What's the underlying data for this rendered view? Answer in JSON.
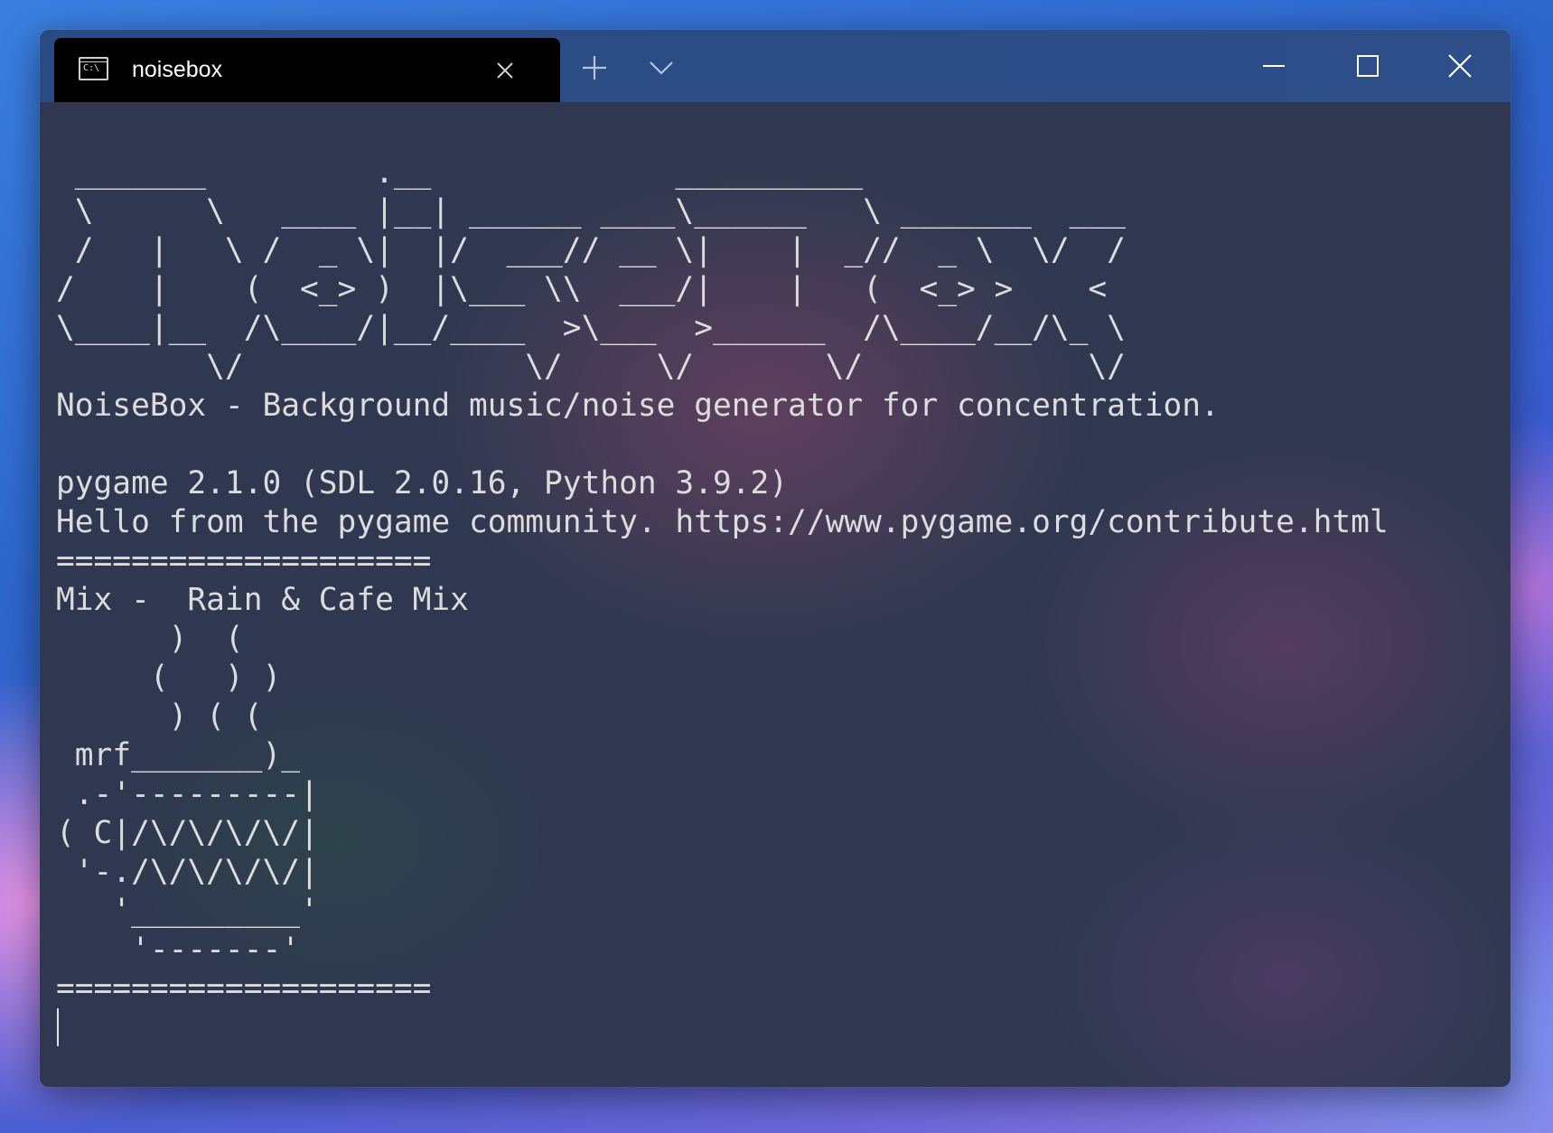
{
  "window": {
    "tab_title": "noisebox",
    "tab_icon_text": "C:\\",
    "icons": {
      "tab_icon": "terminal-icon",
      "tab_close": "close-icon",
      "new_tab": "plus-icon",
      "dropdown": "chevron-down-icon",
      "minimize": "minimize-icon",
      "maximize": "maximize-icon",
      "close": "close-icon"
    }
  },
  "terminal": {
    "lines": [
      " _______         .__             __________",
      " \\      \\   ____ |__| ______ ____\\______   \\ _______  ___",
      " /   |   \\ /  _ \\|  |/  ___// __ \\|    |  _//  _ \\  \\/  /",
      "/    |    (  <_> )  |\\___ \\\\  ___/|    |   (  <_> >    <",
      "\\____|__  /\\____/|__/____  >\\___  >______  /\\____/__/\\_ \\",
      "        \\/               \\/     \\/       \\/            \\/",
      "NoiseBox - Background music/noise generator for concentration.",
      "",
      "pygame 2.1.0 (SDL 2.0.16, Python 3.9.2)",
      "Hello from the pygame community. https://www.pygame.org/contribute.html",
      "====================",
      "Mix -  Rain & Cafe Mix",
      "      )  (",
      "     (   ) )",
      "      ) ( (",
      " mrf_______)_",
      " .-'---------|",
      "( C|/\\/\\/\\/\\/|",
      " '-./\\/\\/\\/\\/|",
      "   '_________'",
      "    '-------'",
      "===================="
    ]
  },
  "colors": {
    "terminal_text": "#dcdcdc",
    "terminal_bg": "#2f3850",
    "titlebar": "#2b4b85",
    "active_tab": "#000000"
  }
}
